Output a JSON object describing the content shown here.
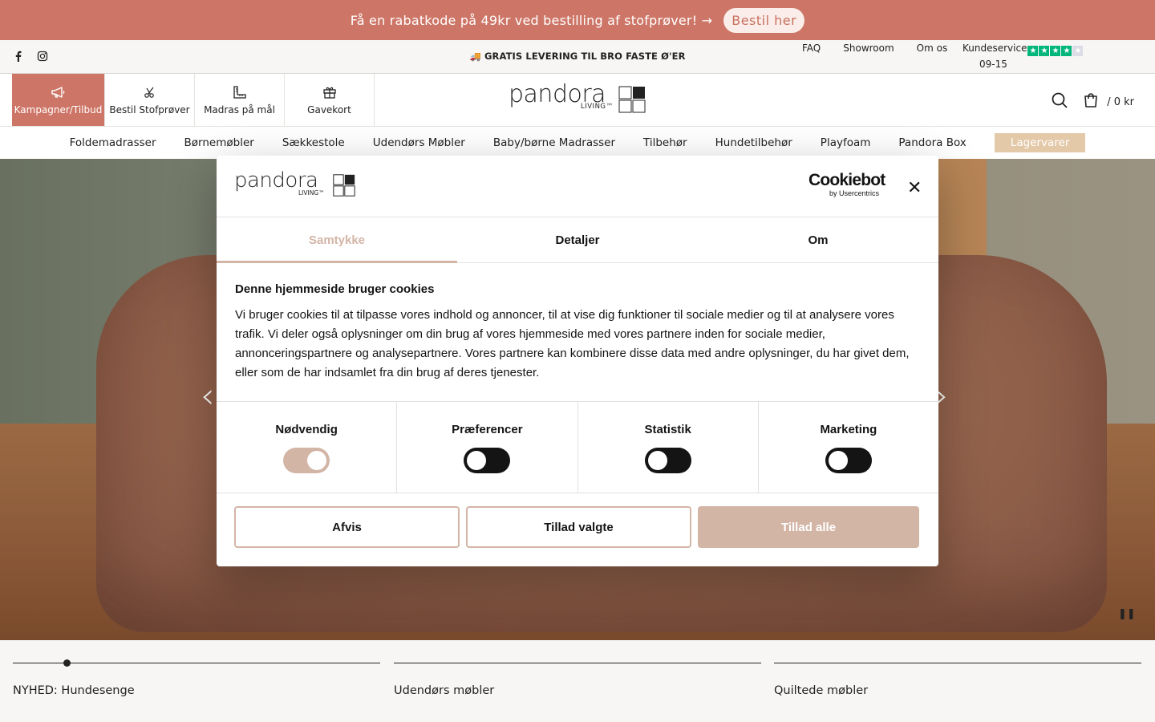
{
  "announcement": {
    "text": "Få en rabatkode på 49kr ved bestilling af stofprøver! →",
    "button": "Bestil her"
  },
  "utility": {
    "social_icons": [
      "facebook-icon",
      "instagram-icon"
    ],
    "shipping": "🚚 GRATIS LEVERING TIL BRO FASTE Ø'ER",
    "links": [
      "FAQ",
      "Showroom",
      "Om os"
    ],
    "kundeservice": "Kundeservice",
    "hours": "09-15",
    "rating_stars": 4
  },
  "header": {
    "quick_links": [
      {
        "label": "Kampagner/Tilbud",
        "icon": "megaphone-icon"
      },
      {
        "label": "Bestil Stofprøver",
        "icon": "scissors-icon"
      },
      {
        "label": "Madras på mål",
        "icon": "ruler-icon"
      },
      {
        "label": "Gavekort",
        "icon": "gift-icon"
      }
    ],
    "logo_word": "pandora",
    "logo_sub": "LIVING™",
    "cart_total": "/ 0 kr"
  },
  "categories": [
    "Foldemadrasser",
    "Børnemøbler",
    "Sækkestole",
    "Udendørs Møbler",
    "Baby/børne Madrasser",
    "Tilbehør",
    "Hundetilbehør",
    "Playfoam",
    "Pandora Box"
  ],
  "categories_highlight": "Lagervarer",
  "slides": [
    {
      "label": "NYHED: Hundesenge"
    },
    {
      "label": "Udendørs møbler"
    },
    {
      "label": "Quiltede møbler"
    }
  ],
  "cookie": {
    "brand": "Cookiebot",
    "brand_sub": "by Usercentrics",
    "tabs": [
      "Samtykke",
      "Detaljer",
      "Om"
    ],
    "active_tab": 0,
    "title": "Denne hjemmeside bruger cookies",
    "body": "Vi bruger cookies til at tilpasse vores indhold og annoncer, til at vise dig funktioner til sociale medier og til at analysere vores trafik. Vi deler også oplysninger om din brug af vores hjemmeside med vores partnere inden for sociale medier, annonceringspartnere og analysepartnere. Vores partnere kan kombinere disse data med andre oplysninger, du har givet dem, eller som de har indsamlet fra din brug af deres tjenester.",
    "toggles": [
      {
        "label": "Nødvendig",
        "on": true
      },
      {
        "label": "Præferencer",
        "on": false
      },
      {
        "label": "Statistik",
        "on": false
      },
      {
        "label": "Marketing",
        "on": false
      }
    ],
    "buttons": {
      "reject": "Afvis",
      "allow_selected": "Tillad valgte",
      "allow_all": "Tillad alle"
    },
    "accent_color": "#d3b5a6"
  },
  "colors": {
    "brand": "#cd7566",
    "highlight": "#e4c9a8"
  }
}
